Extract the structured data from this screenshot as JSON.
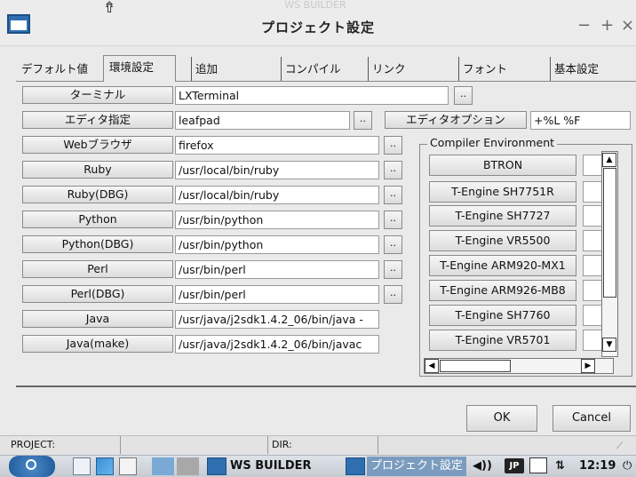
{
  "window": {
    "bg_app_title": "WS BUILDER",
    "title": "プロジェクト設定",
    "minimize": "−",
    "maximize": "+",
    "close": "×",
    "cursor": "⇮"
  },
  "tabs": [
    "デフォルト値",
    "環境設定",
    "追加",
    "コンパイル",
    "リンク",
    "フォント",
    "基本設定"
  ],
  "active_tab": "環境設定",
  "settings": [
    {
      "label": "ターミナル",
      "value": "LXTerminal"
    },
    {
      "label": "エディタ指定",
      "value": "leafpad"
    },
    {
      "label": "Webブラウザ",
      "value": "firefox"
    },
    {
      "label": "Ruby",
      "value": "/usr/local/bin/ruby"
    },
    {
      "label": "Ruby(DBG)",
      "value": "/usr/local/bin/ruby"
    },
    {
      "label": "Python",
      "value": "/usr/bin/python"
    },
    {
      "label": "Python(DBG)",
      "value": "/usr/bin/python"
    },
    {
      "label": "Perl",
      "value": "/usr/bin/perl"
    },
    {
      "label": "Perl(DBG)",
      "value": "/usr/bin/perl"
    },
    {
      "label": "Java",
      "value": "/usr/java/j2sdk1.4.2_06/bin/java -"
    },
    {
      "label": "Java(make)",
      "value": "/usr/java/j2sdk1.4.2_06/bin/javac"
    }
  ],
  "browse_label": "..",
  "editor_option": {
    "label": "エディタオプション",
    "value": "+%L %F"
  },
  "compiler_env": {
    "legend": "Compiler Environment",
    "items": [
      "BTRON",
      "T-Engine SH7751R",
      "T-Engine SH7727",
      "T-Engine VR5500",
      "T-Engine ARM920-MX1",
      "T-Engine ARM926-MB8",
      "T-Engine SH7760",
      "T-Engine VR5701"
    ]
  },
  "dialog": {
    "ok": "OK",
    "cancel": "Cancel"
  },
  "statusbar": {
    "project": "PROJECT:",
    "dir": "DIR:"
  },
  "taskbar": {
    "app1": "WS BUILDER",
    "app2": "プロジェクト設定",
    "volume": "◀))",
    "ime": "JP",
    "clock": "12:19",
    "power": "⏻",
    "network": "⇅"
  }
}
